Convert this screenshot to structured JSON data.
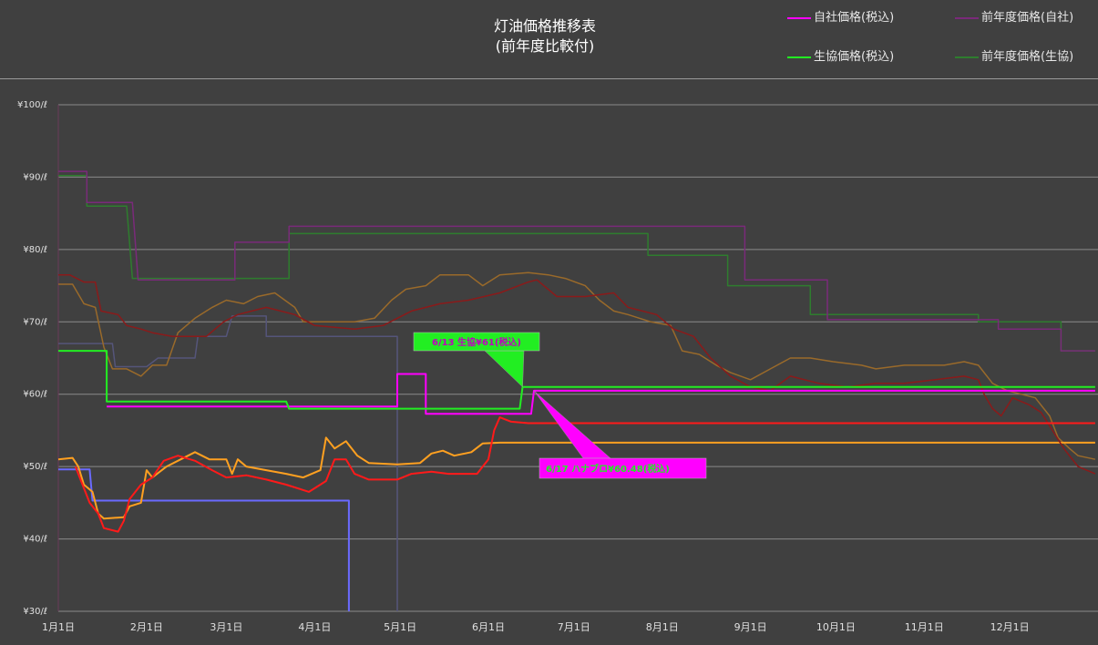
{
  "header": {
    "title_line1": "灯油価格推移表",
    "title_line2": "(前年度比較付)"
  },
  "legend": [
    {
      "label": "自社価格(税込)",
      "color": "#ff00ff"
    },
    {
      "label": "前年度価格(自社)",
      "color": "#7a2a7a"
    },
    {
      "label": "生協価格(税込)",
      "color": "#22ee22"
    },
    {
      "label": "前年度価格(生協)",
      "color": "#2e7d2e"
    }
  ],
  "colors": {
    "background": "#404040",
    "grid": "#8a8a8a",
    "self_price": "#ff00ff",
    "self_prev": "#7a2a7a",
    "coop_price": "#22ee22",
    "coop_prev": "#2e7d2e",
    "red_series": "#ff1a1a",
    "dark_red_series": "#8b1a1a",
    "orange_series": "#ffa020",
    "brown_series": "#9a6a2a",
    "blue_series": "#6a6aff",
    "slate_series": "#55557a"
  },
  "callouts": [
    {
      "text": "6/13 生協¥61(税込)",
      "fill": "#22ee22",
      "text_color": "#c000c0",
      "date": "06-13",
      "value": 61
    },
    {
      "text": "6/17 ハナブロ¥60.48(税込)",
      "fill": "#ff00ff",
      "text_color": "#22ee22",
      "date": "06-17",
      "value": 60.48
    }
  ],
  "chart_data": {
    "type": "line",
    "title": "灯油価格推移表\n(前年度比較付)",
    "ylim": [
      30,
      100
    ],
    "y_ticks": [
      "¥30/ℓ",
      "¥40/ℓ",
      "¥50/ℓ",
      "¥60/ℓ",
      "¥70/ℓ",
      "¥80/ℓ",
      "¥90/ℓ",
      "¥100/ℓ"
    ],
    "y_tick_values": [
      30,
      40,
      50,
      60,
      70,
      80,
      90,
      100
    ],
    "x_ticks": [
      "1月1日",
      "2月1日",
      "3月1日",
      "4月1日",
      "5月1日",
      "6月1日",
      "7月1日",
      "8月1日",
      "9月1日",
      "10月1日",
      "11月1日",
      "12月1日"
    ],
    "x_tick_dates": [
      "01-01",
      "02-01",
      "03-01",
      "04-01",
      "05-01",
      "06-01",
      "07-01",
      "08-01",
      "09-01",
      "10-01",
      "11-01",
      "12-01"
    ],
    "x_end": "12-31",
    "grid": true,
    "legend_position": "top-right",
    "series": [
      {
        "name": "自社価格(税込)",
        "color_key": "self_price",
        "width": 2,
        "points": [
          [
            "01-01",
            null
          ],
          [
            "01-18",
            58.3
          ],
          [
            "04-30",
            58.3
          ],
          [
            "04-30",
            62.8
          ],
          [
            "05-10",
            62.8
          ],
          [
            "05-10",
            57.3
          ],
          [
            "06-16",
            57.3
          ],
          [
            "06-17",
            60.48
          ],
          [
            "12-31",
            60.48
          ]
        ]
      },
      {
        "name": "前年度価格(自社)",
        "color_key": "self_prev",
        "width": 1.5,
        "points": [
          [
            "01-01",
            90.8
          ],
          [
            "01-11",
            90.8
          ],
          [
            "01-11",
            86.5
          ],
          [
            "01-27",
            86.5
          ],
          [
            "01-29",
            75.8
          ],
          [
            "03-04",
            75.8
          ],
          [
            "03-04",
            81.0
          ],
          [
            "03-23",
            81.0
          ],
          [
            "03-23",
            83.2
          ],
          [
            "08-30",
            83.2
          ],
          [
            "08-30",
            75.8
          ],
          [
            "09-28",
            75.8
          ],
          [
            "09-28",
            70.3
          ],
          [
            "11-27",
            70.3
          ],
          [
            "11-27",
            69.0
          ],
          [
            "12-19",
            69.0
          ],
          [
            "12-19",
            66.0
          ],
          [
            "12-31",
            66.0
          ]
        ]
      },
      {
        "name": "生協価格(税込)",
        "color_key": "coop_price",
        "width": 2,
        "points": [
          [
            "01-01",
            66.0
          ],
          [
            "01-18",
            66.0
          ],
          [
            "01-18",
            59.0
          ],
          [
            "03-22",
            59.0
          ],
          [
            "03-23",
            58.0
          ],
          [
            "06-12",
            58.0
          ],
          [
            "06-13",
            61.0
          ],
          [
            "12-31",
            61.0
          ]
        ]
      },
      {
        "name": "前年度価格(生協)",
        "color_key": "coop_prev",
        "width": 1.5,
        "points": [
          [
            "01-01",
            90.2
          ],
          [
            "01-11",
            90.2
          ],
          [
            "01-11",
            86.0
          ],
          [
            "01-25",
            86.0
          ],
          [
            "01-27",
            76.0
          ],
          [
            "03-23",
            76.0
          ],
          [
            "03-23",
            82.2
          ],
          [
            "07-27",
            82.2
          ],
          [
            "07-27",
            79.2
          ],
          [
            "08-24",
            79.2
          ],
          [
            "08-24",
            75.0
          ],
          [
            "09-22",
            75.0
          ],
          [
            "09-22",
            71.0
          ],
          [
            "11-20",
            71.0
          ],
          [
            "11-20",
            70.0
          ],
          [
            "12-19",
            70.0
          ],
          [
            "12-19",
            66.0
          ],
          [
            "12-31",
            66.0
          ]
        ]
      },
      {
        "color_key": "red_series",
        "width": 2,
        "points": [
          [
            "01-07",
            50.0
          ],
          [
            "01-09",
            48.0
          ],
          [
            "01-12",
            45.0
          ],
          [
            "01-15",
            43.5
          ],
          [
            "01-17",
            41.5
          ],
          [
            "01-22",
            41.0
          ],
          [
            "01-24",
            42.5
          ],
          [
            "01-26",
            45.5
          ],
          [
            "01-30",
            47.5
          ],
          [
            "02-03",
            48.5
          ],
          [
            "02-07",
            50.8
          ],
          [
            "02-12",
            51.5
          ],
          [
            "02-18",
            50.8
          ],
          [
            "02-24",
            49.5
          ],
          [
            "03-01",
            48.5
          ],
          [
            "03-08",
            48.8
          ],
          [
            "03-15",
            48.2
          ],
          [
            "03-22",
            47.5
          ],
          [
            "03-30",
            46.5
          ],
          [
            "04-05",
            48.0
          ],
          [
            "04-08",
            51.0
          ],
          [
            "04-12",
            51.0
          ],
          [
            "04-15",
            49.0
          ],
          [
            "04-20",
            48.2
          ],
          [
            "04-30",
            48.2
          ],
          [
            "05-05",
            49.0
          ],
          [
            "05-12",
            49.3
          ],
          [
            "05-18",
            49.0
          ],
          [
            "05-28",
            49.0
          ],
          [
            "06-01",
            51.0
          ],
          [
            "06-03",
            55.0
          ],
          [
            "06-05",
            56.8
          ],
          [
            "06-09",
            56.2
          ],
          [
            "06-15",
            56.0
          ],
          [
            "12-31",
            56.0
          ]
        ]
      },
      {
        "color_key": "dark_red_series",
        "width": 1.5,
        "points": [
          [
            "01-01",
            76.5
          ],
          [
            "01-05",
            76.5
          ],
          [
            "01-10",
            75.5
          ],
          [
            "01-14",
            75.5
          ],
          [
            "01-16",
            71.5
          ],
          [
            "01-22",
            71.0
          ],
          [
            "01-25",
            69.5
          ],
          [
            "01-30",
            69.0
          ],
          [
            "02-03",
            68.5
          ],
          [
            "02-10",
            68.0
          ],
          [
            "02-22",
            68.0
          ],
          [
            "02-28",
            70.0
          ],
          [
            "03-05",
            71.0
          ],
          [
            "03-15",
            72.0
          ],
          [
            "03-25",
            71.0
          ],
          [
            "04-01",
            69.5
          ],
          [
            "04-15",
            69.0
          ],
          [
            "04-25",
            69.5
          ],
          [
            "05-05",
            71.5
          ],
          [
            "05-15",
            72.5
          ],
          [
            "05-25",
            73.0
          ],
          [
            "06-05",
            74.0
          ],
          [
            "06-15",
            75.5
          ],
          [
            "06-18",
            75.8
          ],
          [
            "06-25",
            73.5
          ],
          [
            "07-05",
            73.5
          ],
          [
            "07-15",
            74.0
          ],
          [
            "07-20",
            72.0
          ],
          [
            "07-30",
            71.0
          ],
          [
            "08-05",
            69.0
          ],
          [
            "08-12",
            68.0
          ],
          [
            "08-18",
            65.0
          ],
          [
            "08-25",
            62.5
          ],
          [
            "09-01",
            61.0
          ],
          [
            "09-08",
            60.5
          ],
          [
            "09-15",
            62.5
          ],
          [
            "09-25",
            61.5
          ],
          [
            "10-05",
            61.0
          ],
          [
            "10-15",
            61.5
          ],
          [
            "10-25",
            61.5
          ],
          [
            "11-05",
            62.0
          ],
          [
            "11-15",
            62.5
          ],
          [
            "11-20",
            62.0
          ],
          [
            "11-22",
            60.0
          ],
          [
            "11-25",
            58.0
          ],
          [
            "11-28",
            57.0
          ],
          [
            "12-02",
            59.5
          ],
          [
            "12-08",
            58.5
          ],
          [
            "12-12",
            57.5
          ],
          [
            "12-16",
            55.0
          ],
          [
            "12-20",
            52.5
          ],
          [
            "12-25",
            50.0
          ],
          [
            "12-31",
            49.0
          ]
        ]
      },
      {
        "color_key": "orange_series",
        "width": 2,
        "points": [
          [
            "01-01",
            51.0
          ],
          [
            "01-06",
            51.2
          ],
          [
            "01-08",
            50.0
          ],
          [
            "01-10",
            47.5
          ],
          [
            "01-13",
            46.5
          ],
          [
            "01-15",
            43.5
          ],
          [
            "01-17",
            42.8
          ],
          [
            "01-24",
            43.0
          ],
          [
            "01-26",
            44.5
          ],
          [
            "01-30",
            45.0
          ],
          [
            "02-01",
            49.5
          ],
          [
            "02-03",
            48.5
          ],
          [
            "02-08",
            50.0
          ],
          [
            "02-13",
            51.0
          ],
          [
            "02-18",
            52.0
          ],
          [
            "02-23",
            51.0
          ],
          [
            "03-01",
            51.0
          ],
          [
            "03-03",
            49.0
          ],
          [
            "03-05",
            51.0
          ],
          [
            "03-08",
            50.0
          ],
          [
            "03-15",
            49.5
          ],
          [
            "03-22",
            49.0
          ],
          [
            "03-28",
            48.5
          ],
          [
            "04-03",
            49.5
          ],
          [
            "04-05",
            54.0
          ],
          [
            "04-08",
            52.5
          ],
          [
            "04-12",
            53.5
          ],
          [
            "04-16",
            51.5
          ],
          [
            "04-20",
            50.5
          ],
          [
            "04-30",
            50.3
          ],
          [
            "05-08",
            50.5
          ],
          [
            "05-12",
            51.8
          ],
          [
            "05-16",
            52.2
          ],
          [
            "05-20",
            51.5
          ],
          [
            "05-26",
            52.0
          ],
          [
            "05-30",
            53.2
          ],
          [
            "06-05",
            53.3
          ],
          [
            "12-31",
            53.3
          ]
        ]
      },
      {
        "color_key": "brown_series",
        "width": 1.5,
        "points": [
          [
            "01-01",
            75.2
          ],
          [
            "01-06",
            75.2
          ],
          [
            "01-10",
            72.5
          ],
          [
            "01-14",
            72.0
          ],
          [
            "01-17",
            66.5
          ],
          [
            "01-20",
            63.5
          ],
          [
            "01-25",
            63.5
          ],
          [
            "01-30",
            62.5
          ],
          [
            "02-03",
            64.0
          ],
          [
            "02-08",
            64.0
          ],
          [
            "02-12",
            68.5
          ],
          [
            "02-18",
            70.5
          ],
          [
            "02-24",
            72.0
          ],
          [
            "03-01",
            73.0
          ],
          [
            "03-07",
            72.5
          ],
          [
            "03-12",
            73.5
          ],
          [
            "03-18",
            74.0
          ],
          [
            "03-25",
            72.0
          ],
          [
            "03-28",
            70.0
          ],
          [
            "04-05",
            70.0
          ],
          [
            "04-15",
            70.0
          ],
          [
            "04-22",
            70.5
          ],
          [
            "04-28",
            73.0
          ],
          [
            "05-03",
            74.5
          ],
          [
            "05-10",
            75.0
          ],
          [
            "05-15",
            76.5
          ],
          [
            "05-25",
            76.5
          ],
          [
            "05-30",
            75.0
          ],
          [
            "06-05",
            76.5
          ],
          [
            "06-15",
            76.8
          ],
          [
            "06-22",
            76.5
          ],
          [
            "06-28",
            76.0
          ],
          [
            "07-05",
            75.0
          ],
          [
            "07-10",
            73.0
          ],
          [
            "07-15",
            71.5
          ],
          [
            "07-20",
            71.0
          ],
          [
            "07-28",
            70.0
          ],
          [
            "08-04",
            69.5
          ],
          [
            "08-08",
            66.0
          ],
          [
            "08-14",
            65.5
          ],
          [
            "08-20",
            64.0
          ],
          [
            "08-25",
            63.0
          ],
          [
            "09-01",
            62.0
          ],
          [
            "09-08",
            63.5
          ],
          [
            "09-15",
            65.0
          ],
          [
            "09-22",
            65.0
          ],
          [
            "09-30",
            64.5
          ],
          [
            "10-10",
            64.0
          ],
          [
            "10-15",
            63.5
          ],
          [
            "10-25",
            64.0
          ],
          [
            "11-01",
            64.0
          ],
          [
            "11-08",
            64.0
          ],
          [
            "11-15",
            64.5
          ],
          [
            "11-20",
            64.0
          ],
          [
            "11-25",
            61.5
          ],
          [
            "11-30",
            60.5
          ],
          [
            "12-05",
            60.0
          ],
          [
            "12-10",
            59.5
          ],
          [
            "12-15",
            57.0
          ],
          [
            "12-18",
            54.0
          ],
          [
            "12-22",
            52.5
          ],
          [
            "12-25",
            51.5
          ],
          [
            "12-31",
            51.0
          ]
        ]
      },
      {
        "color_key": "blue_series",
        "width": 2,
        "points": [
          [
            "01-01",
            49.6
          ],
          [
            "01-12",
            49.6
          ],
          [
            "01-13",
            45.3
          ],
          [
            "04-13",
            45.3
          ],
          [
            "04-13",
            30.0
          ]
        ]
      },
      {
        "color_key": "slate_series",
        "width": 1.5,
        "points": [
          [
            "01-01",
            67.0
          ],
          [
            "01-20",
            67.0
          ],
          [
            "01-21",
            63.8
          ],
          [
            "02-01",
            63.8
          ],
          [
            "02-05",
            65.0
          ],
          [
            "02-18",
            65.0
          ],
          [
            "02-19",
            68.0
          ],
          [
            "03-01",
            68.0
          ],
          [
            "03-03",
            70.8
          ],
          [
            "03-15",
            70.8
          ],
          [
            "03-15",
            68.0
          ],
          [
            "04-30",
            68.0
          ],
          [
            "04-30",
            30.0
          ]
        ]
      }
    ]
  }
}
